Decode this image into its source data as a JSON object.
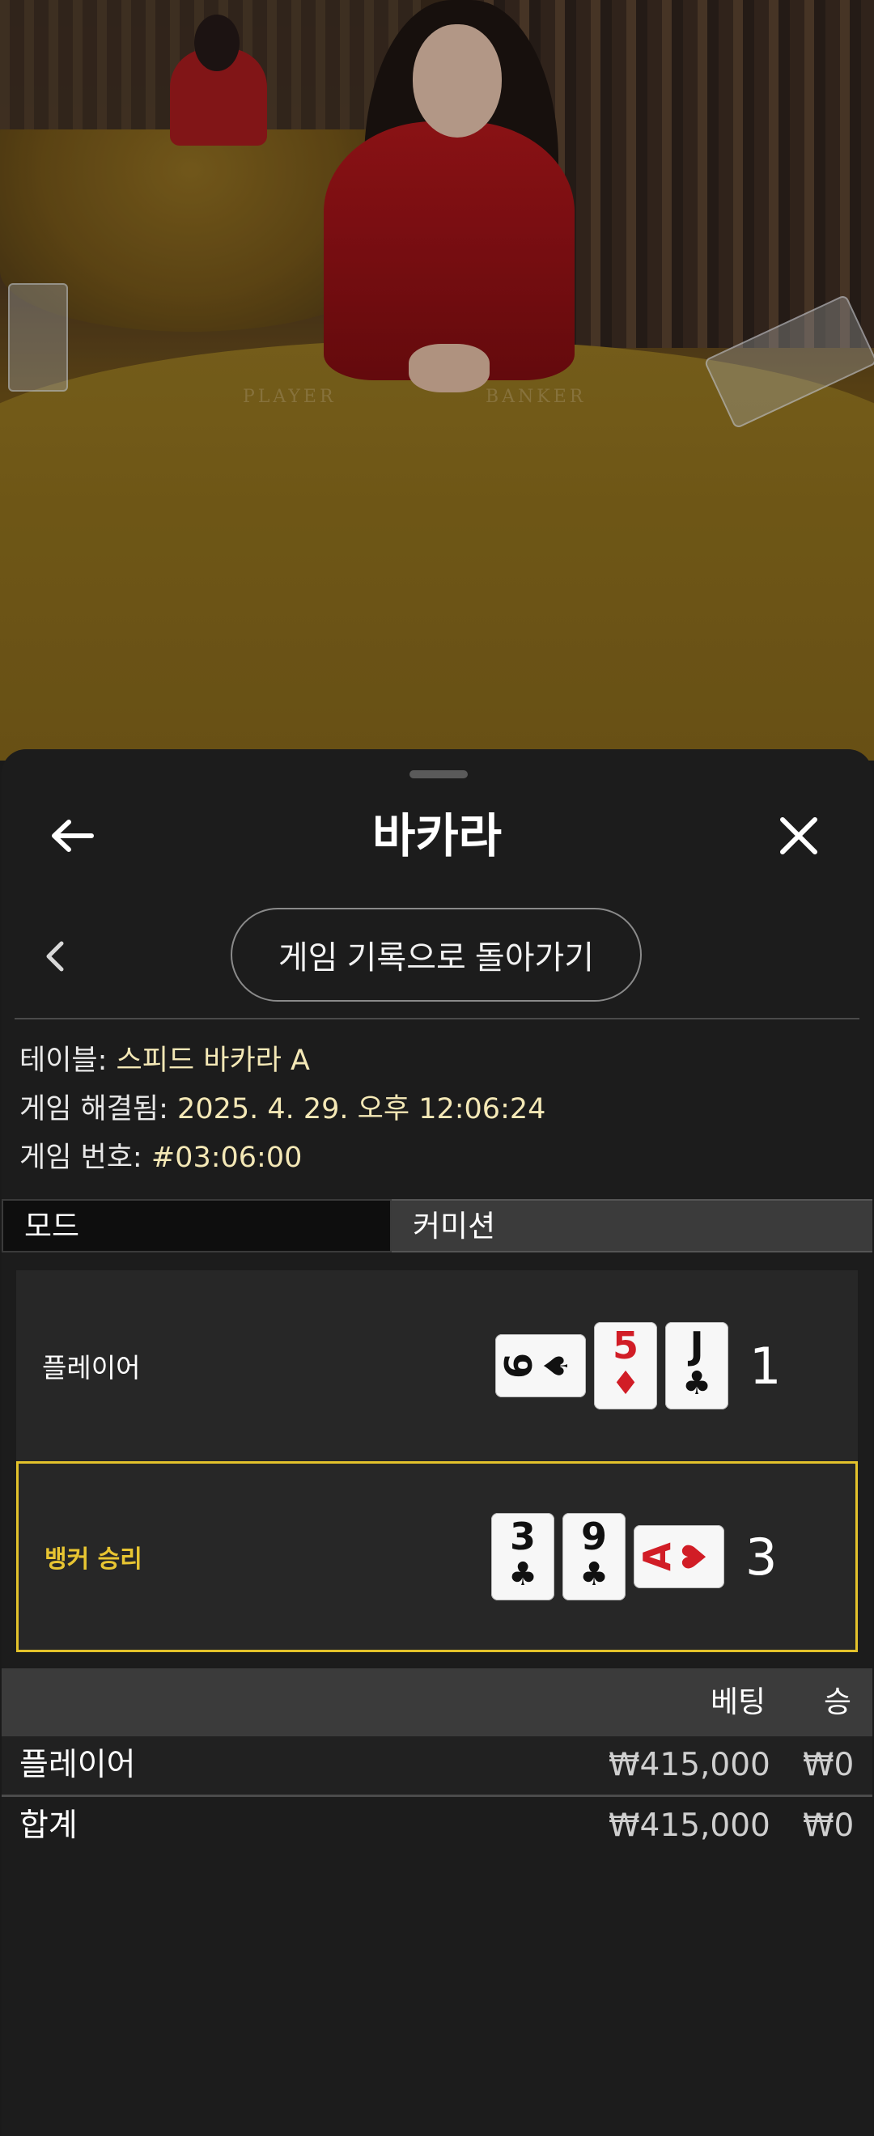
{
  "video": {
    "table_left_label": "PLAYER",
    "table_right_label": "BANKER"
  },
  "header": {
    "title": "바카라",
    "back_icon": "arrow-left-icon",
    "close_icon": "close-icon"
  },
  "nav": {
    "back_to_history": "게임 기록으로 돌아가기"
  },
  "info": {
    "table_label": "테이블: ",
    "table_value": "스피드 바카라 A",
    "resolved_label": "게임 해결됨: ",
    "resolved_value": "2025. 4. 29. 오후 12:06:24",
    "game_no_label": "게임 번호: ",
    "game_no_value": "#03:06:00"
  },
  "tabs": [
    {
      "label": "모드",
      "active": true
    },
    {
      "label": "커미션",
      "active": false
    }
  ],
  "hands": {
    "player": {
      "label": "플레이어",
      "score": "1",
      "cards": [
        {
          "rank": "6",
          "suit": "♠",
          "sideways": true,
          "color": "black"
        },
        {
          "rank": "5",
          "suit": "♦",
          "sideways": false,
          "color": "red"
        },
        {
          "rank": "J",
          "suit": "♣",
          "sideways": false,
          "color": "black"
        }
      ]
    },
    "banker": {
      "label": "뱅커 승리",
      "score": "3",
      "winner": true,
      "cards": [
        {
          "rank": "3",
          "suit": "♣",
          "sideways": false,
          "color": "black"
        },
        {
          "rank": "9",
          "suit": "♣",
          "sideways": false,
          "color": "black"
        },
        {
          "rank": "A",
          "suit": "♥",
          "sideways": true,
          "color": "red"
        }
      ]
    }
  },
  "bets": {
    "headers": {
      "bet": "베팅",
      "win": "승"
    },
    "rows": [
      {
        "name": "플레이어",
        "bet": "₩415,000",
        "win": "₩0"
      }
    ],
    "total": {
      "name": "합계",
      "bet": "₩415,000",
      "win": "₩0"
    }
  },
  "colors": {
    "accent_win": "#e3c22b",
    "info_value": "#f4e8b6",
    "card_red": "#d11d26"
  }
}
